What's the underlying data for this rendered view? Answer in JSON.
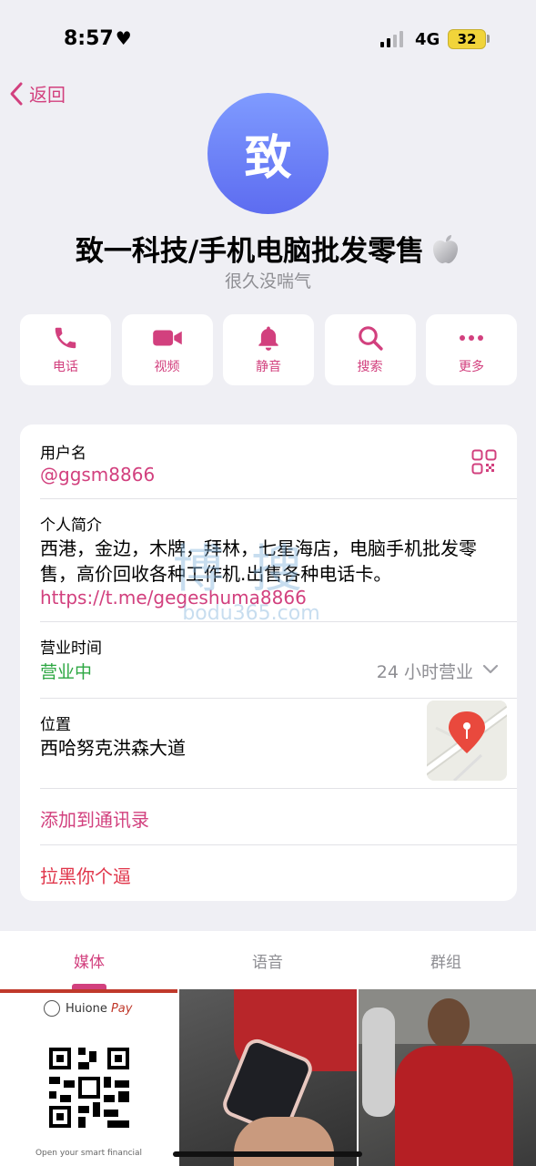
{
  "status": {
    "time": "8:57",
    "network": "4G",
    "battery": "32"
  },
  "nav": {
    "back_label": "返回"
  },
  "profile": {
    "avatar_char": "致",
    "name": "致一科技/手机电脑批发零售",
    "last_seen": "很久没喘气"
  },
  "actions": [
    {
      "label": "电话",
      "icon": "phone-icon"
    },
    {
      "label": "视频",
      "icon": "video-icon"
    },
    {
      "label": "静音",
      "icon": "bell-icon"
    },
    {
      "label": "搜索",
      "icon": "search-icon"
    },
    {
      "label": "更多",
      "icon": "more-icon"
    }
  ],
  "info": {
    "username_label": "用户名",
    "username": "@ggsm8866",
    "bio_label": "个人简介",
    "bio_text": "西港，金边，木牌，拜林，七星海店，电脑手机批发零售，高价回收各种工作机.出售各种电话卡。",
    "bio_link": "https://t.me/gegeshuma8866",
    "hours_label": "营业时间",
    "hours_status": "营业中",
    "hours_value": "24 小时营业",
    "location_label": "位置",
    "location_value": "西哈努克洪森大道",
    "add_contact": "添加到通讯录",
    "block": "拉黑你个逼"
  },
  "watermark": {
    "main": "博搜",
    "sub": "bodu365.com"
  },
  "tabs": [
    {
      "label": "媒体",
      "active": true
    },
    {
      "label": "语音",
      "active": false
    },
    {
      "label": "群组",
      "active": false
    }
  ],
  "media_tile1": {
    "brand": "Huione",
    "brand_suffix": "Pay",
    "caption": "Open your smart financial"
  },
  "colors": {
    "accent": "#d2407e",
    "green": "#2ca742",
    "avatar_top": "#7f9bff",
    "avatar_bottom": "#5d6cf0"
  }
}
